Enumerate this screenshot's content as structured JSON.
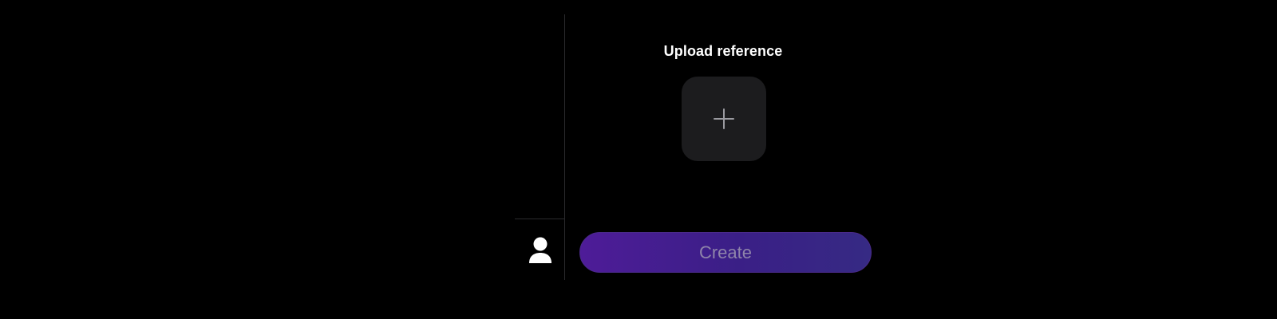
{
  "upload": {
    "title": "Upload reference",
    "add_icon": "plus-icon"
  },
  "user": {
    "avatar_icon": "user-icon"
  },
  "actions": {
    "create_label": "Create"
  },
  "colors": {
    "background": "#000000",
    "tile": "#1c1c1e",
    "divider": "#2b2b2e",
    "button_gradient_start": "#4e1c98",
    "button_gradient_end": "#362a84",
    "button_text": "#8f84aa"
  }
}
